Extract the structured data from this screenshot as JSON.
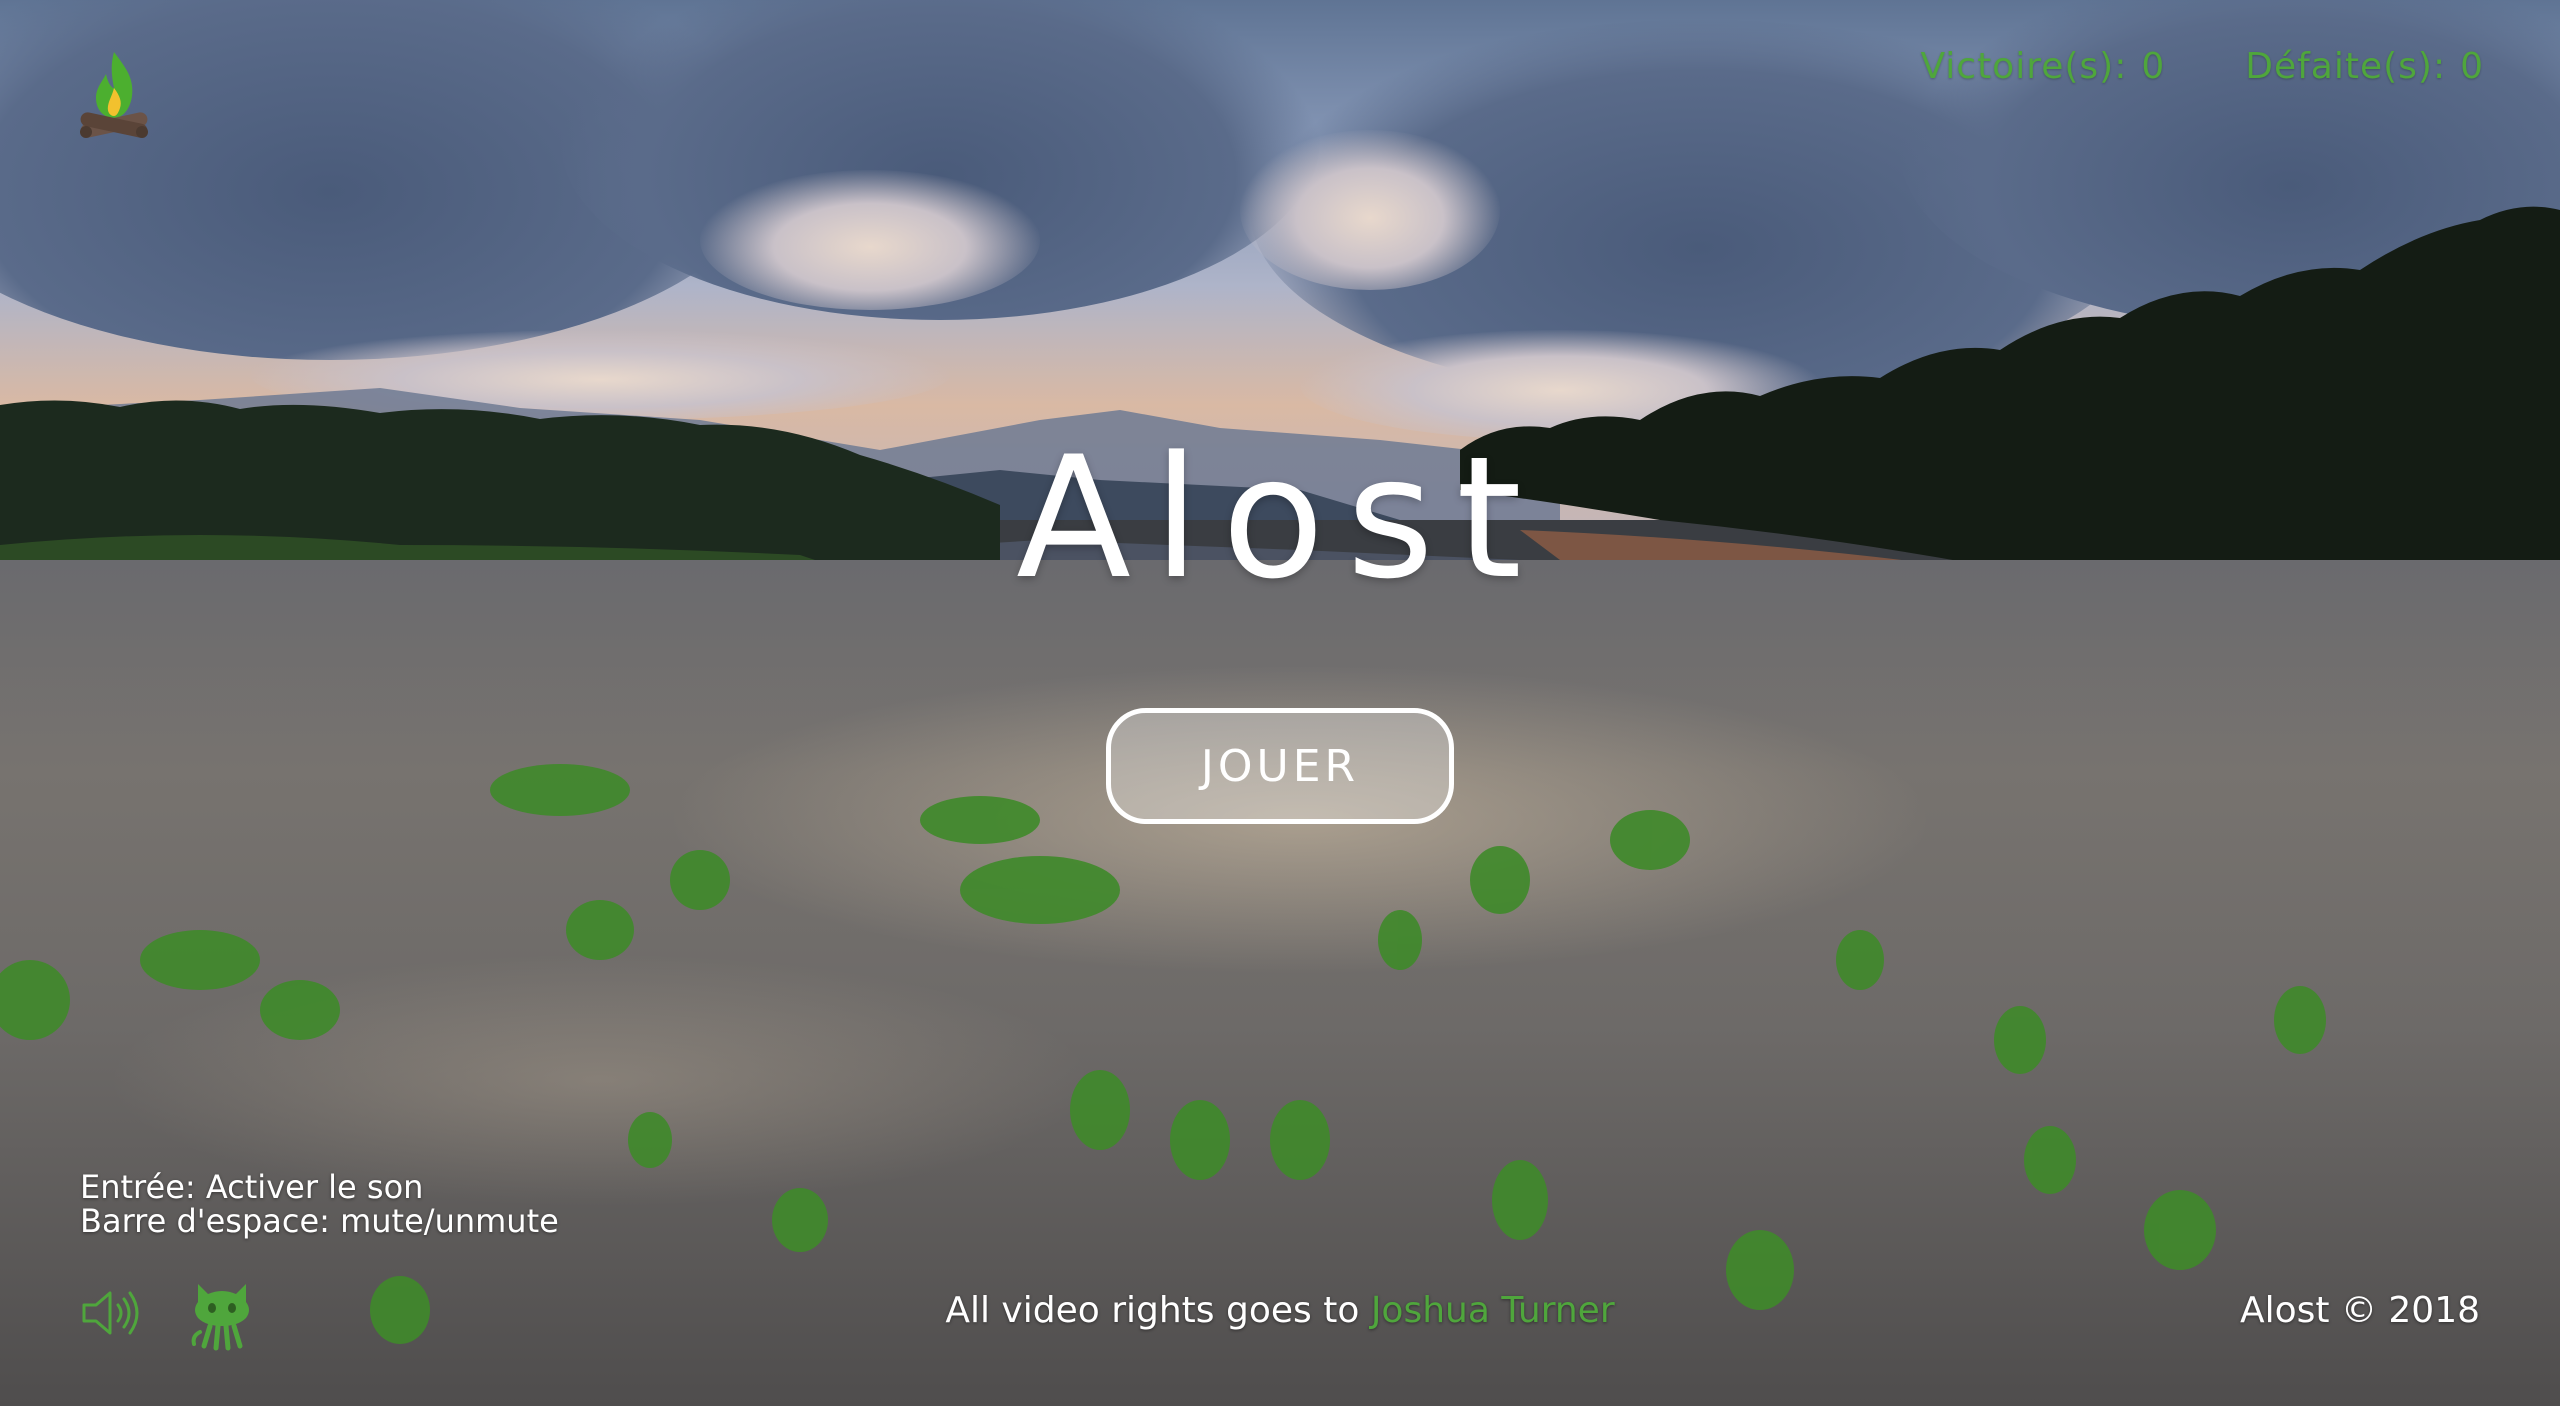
{
  "hud": {
    "wins_label": "Victoire(s):",
    "wins_value": "0",
    "losses_label": "Défaite(s):",
    "losses_value": "0"
  },
  "game": {
    "title": "Alost",
    "play_label": "JOUER"
  },
  "controls": {
    "enter_hint": "Entrée: Activer le son",
    "space_hint": "Barre d'espace: mute/unmute"
  },
  "footer": {
    "credits_prefix": "All video rights goes to",
    "credits_author": "Joshua Turner",
    "copyright": "Alost © 2018"
  },
  "icons": {
    "logo": "campfire-icon",
    "sound": "speaker-icon",
    "github": "github-octocat-icon"
  },
  "colors": {
    "accent_green": "#4fa63c",
    "text_white": "#ffffff"
  }
}
